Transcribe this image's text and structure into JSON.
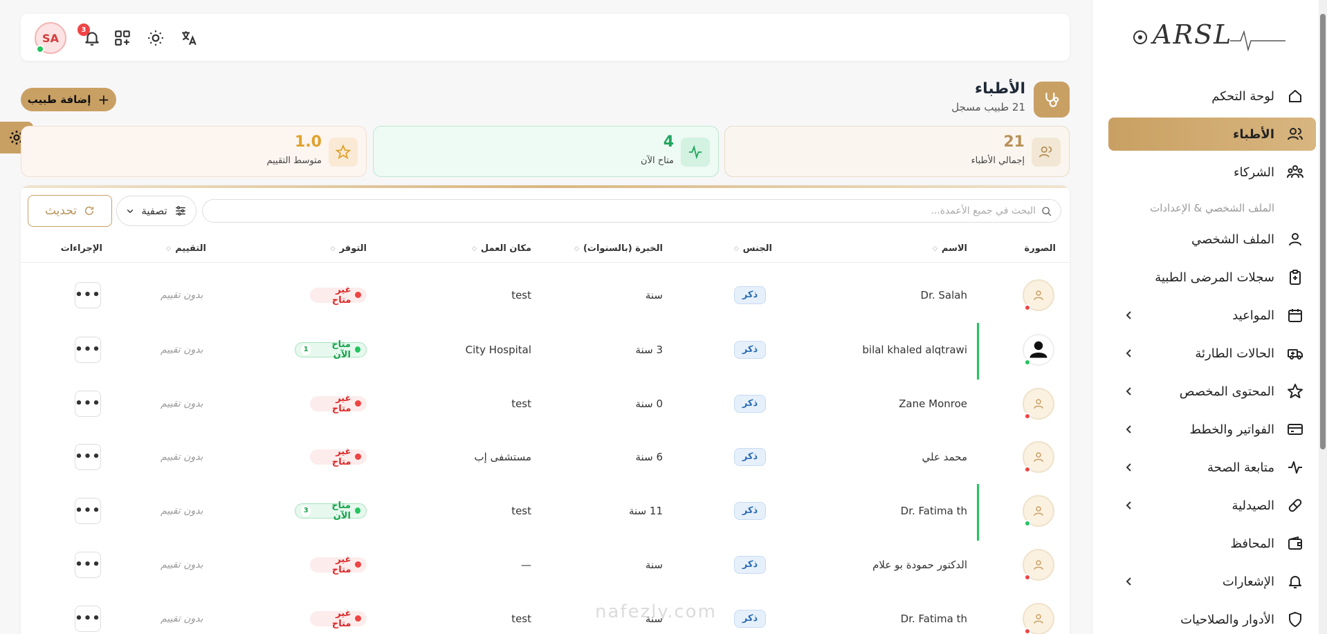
{
  "sidebar": {
    "brand": "ARSL",
    "items": [
      {
        "label": "لوحة التحكم",
        "icon": "home-icon"
      },
      {
        "label": "الأطباء",
        "icon": "users-icon",
        "active": true
      },
      {
        "label": "الشركاء",
        "icon": "partners-icon"
      }
    ],
    "section_label": "الملف الشخصي & الإعدادات",
    "items2": [
      {
        "label": "الملف الشخصي",
        "icon": "user-icon"
      },
      {
        "label": "سجلات المرضى الطبية",
        "icon": "clipboard-icon"
      },
      {
        "label": "المواعيد",
        "icon": "calendar-icon",
        "expandable": true
      },
      {
        "label": "الحالات الطارئة",
        "icon": "ambulance-icon",
        "expandable": true
      },
      {
        "label": "المحتوى المخصص",
        "icon": "star-icon",
        "expandable": true
      },
      {
        "label": "الفواتير والخطط",
        "icon": "credit-card-icon",
        "expandable": true
      },
      {
        "label": "متابعة الصحة",
        "icon": "activity-icon",
        "expandable": true
      },
      {
        "label": "الصيدلية",
        "icon": "pill-icon",
        "expandable": true
      },
      {
        "label": "المحافظ",
        "icon": "wallet-icon"
      },
      {
        "label": "الإشعارات",
        "icon": "bell-icon",
        "expandable": true
      },
      {
        "label": "الأدوار والصلاحيات",
        "icon": "shield-icon"
      }
    ]
  },
  "topbar": {
    "avatar_initials": "SA",
    "notification_count": "3"
  },
  "header": {
    "title": "الأطباء",
    "subtitle": "21 طبيب مسجل",
    "add_button": "إضافة طبيب"
  },
  "stats": [
    {
      "value": "21",
      "label": "إجمالي الأطباء"
    },
    {
      "value": "4",
      "label": "متاح الآن"
    },
    {
      "value": "1.0",
      "label": "متوسط التقييم"
    }
  ],
  "table": {
    "search_placeholder": "البحث في جميع الأعمدة...",
    "filter_label": "تصفية",
    "refresh_label": "تحديث",
    "columns": {
      "photo": "الصورة",
      "name": "الاسم",
      "gender": "الجنس",
      "experience": "الخبرة (بالسنوات)",
      "workplace": "مكان العمل",
      "availability": "التوفر",
      "rating": "التقييم",
      "actions": "الإجراءات"
    },
    "rows": [
      {
        "name": "Dr. Salah",
        "gender": "ذكر",
        "experience": "سنة",
        "workplace": "test",
        "availability": "غير متاح",
        "available": false,
        "rating": "بدون تقييم",
        "online": false
      },
      {
        "name": "bilal khaled alqtrawi",
        "gender": "ذكر",
        "experience": "3 سنة",
        "workplace": "City Hospital",
        "availability": "متاح الآن",
        "available": true,
        "count": "1",
        "rating": "بدون تقييم",
        "online": true,
        "photo": true
      },
      {
        "name": "Zane Monroe",
        "gender": "ذكر",
        "experience": "0 سنة",
        "workplace": "test",
        "availability": "غير متاح",
        "available": false,
        "rating": "بدون تقييم",
        "online": false
      },
      {
        "name": "محمد علي",
        "gender": "ذكر",
        "experience": "6 سنة",
        "workplace": "مستشفى إب",
        "availability": "غير متاح",
        "available": false,
        "rating": "بدون تقييم",
        "online": false
      },
      {
        "name": "Dr. Fatima th",
        "gender": "ذكر",
        "experience": "11 سنة",
        "workplace": "test",
        "availability": "متاح الآن",
        "available": true,
        "count": "3",
        "rating": "بدون تقييم",
        "online": true
      },
      {
        "name": "الدكتور حمودة بو علام",
        "gender": "ذكر",
        "experience": "سنة",
        "workplace": "—",
        "availability": "غير متاح",
        "available": false,
        "rating": "بدون تقييم",
        "online": false
      },
      {
        "name": "Dr. Fatima th",
        "gender": "ذكر",
        "experience": "سنة",
        "workplace": "test",
        "availability": "غير متاح",
        "available": false,
        "rating": "بدون تقييم",
        "online": false
      }
    ]
  },
  "colors": {
    "accent": "#c9a063",
    "available": "#22c55e",
    "unavailable": "#ef4444"
  },
  "watermark": "nafezly.com"
}
